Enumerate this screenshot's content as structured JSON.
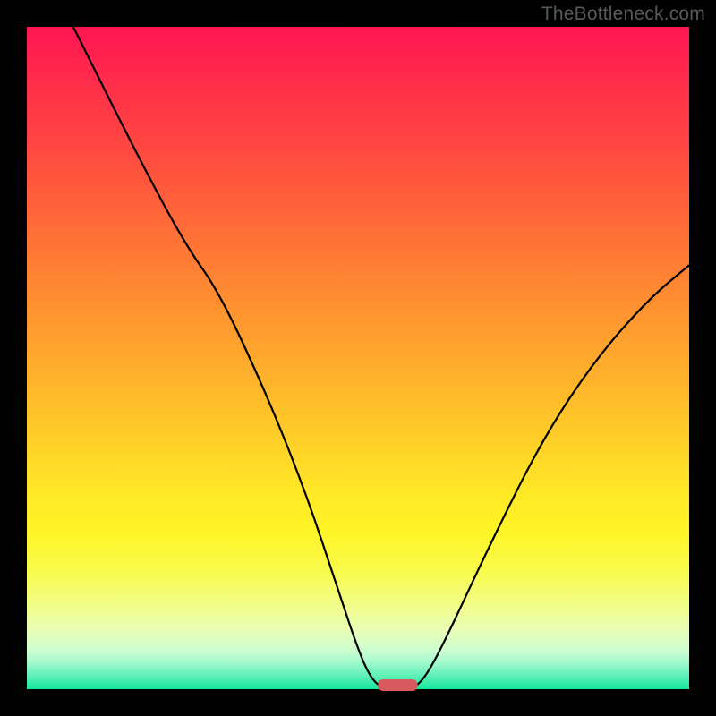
{
  "watermark": "TheBottleneck.com",
  "chart_data": {
    "type": "line",
    "title": "",
    "xlabel": "",
    "ylabel": "",
    "xlim": [
      0,
      100
    ],
    "ylim": [
      0,
      100
    ],
    "background_gradient": {
      "top": "#ff1551",
      "bottom": "#15e79e",
      "stops": [
        "#ff1551",
        "#ff4741",
        "#ff9a2f",
        "#ffe726",
        "#f2fd84",
        "#15e79e"
      ]
    },
    "series": [
      {
        "name": "bottleneck-curve",
        "points": [
          {
            "x": 7,
            "y": 100
          },
          {
            "x": 17,
            "y": 80
          },
          {
            "x": 24,
            "y": 67
          },
          {
            "x": 29,
            "y": 60
          },
          {
            "x": 36,
            "y": 45
          },
          {
            "x": 42,
            "y": 30
          },
          {
            "x": 47,
            "y": 15
          },
          {
            "x": 50,
            "y": 6
          },
          {
            "x": 52,
            "y": 1.5
          },
          {
            "x": 54,
            "y": 0
          },
          {
            "x": 58,
            "y": 0
          },
          {
            "x": 60,
            "y": 1.5
          },
          {
            "x": 63,
            "y": 7
          },
          {
            "x": 70,
            "y": 22
          },
          {
            "x": 78,
            "y": 38
          },
          {
            "x": 86,
            "y": 50
          },
          {
            "x": 94,
            "y": 59
          },
          {
            "x": 100,
            "y": 64
          }
        ]
      }
    ],
    "marker": {
      "name": "optimal-marker",
      "x_center": 56,
      "width": 6,
      "y": 0,
      "color": "#d85a5d"
    }
  }
}
